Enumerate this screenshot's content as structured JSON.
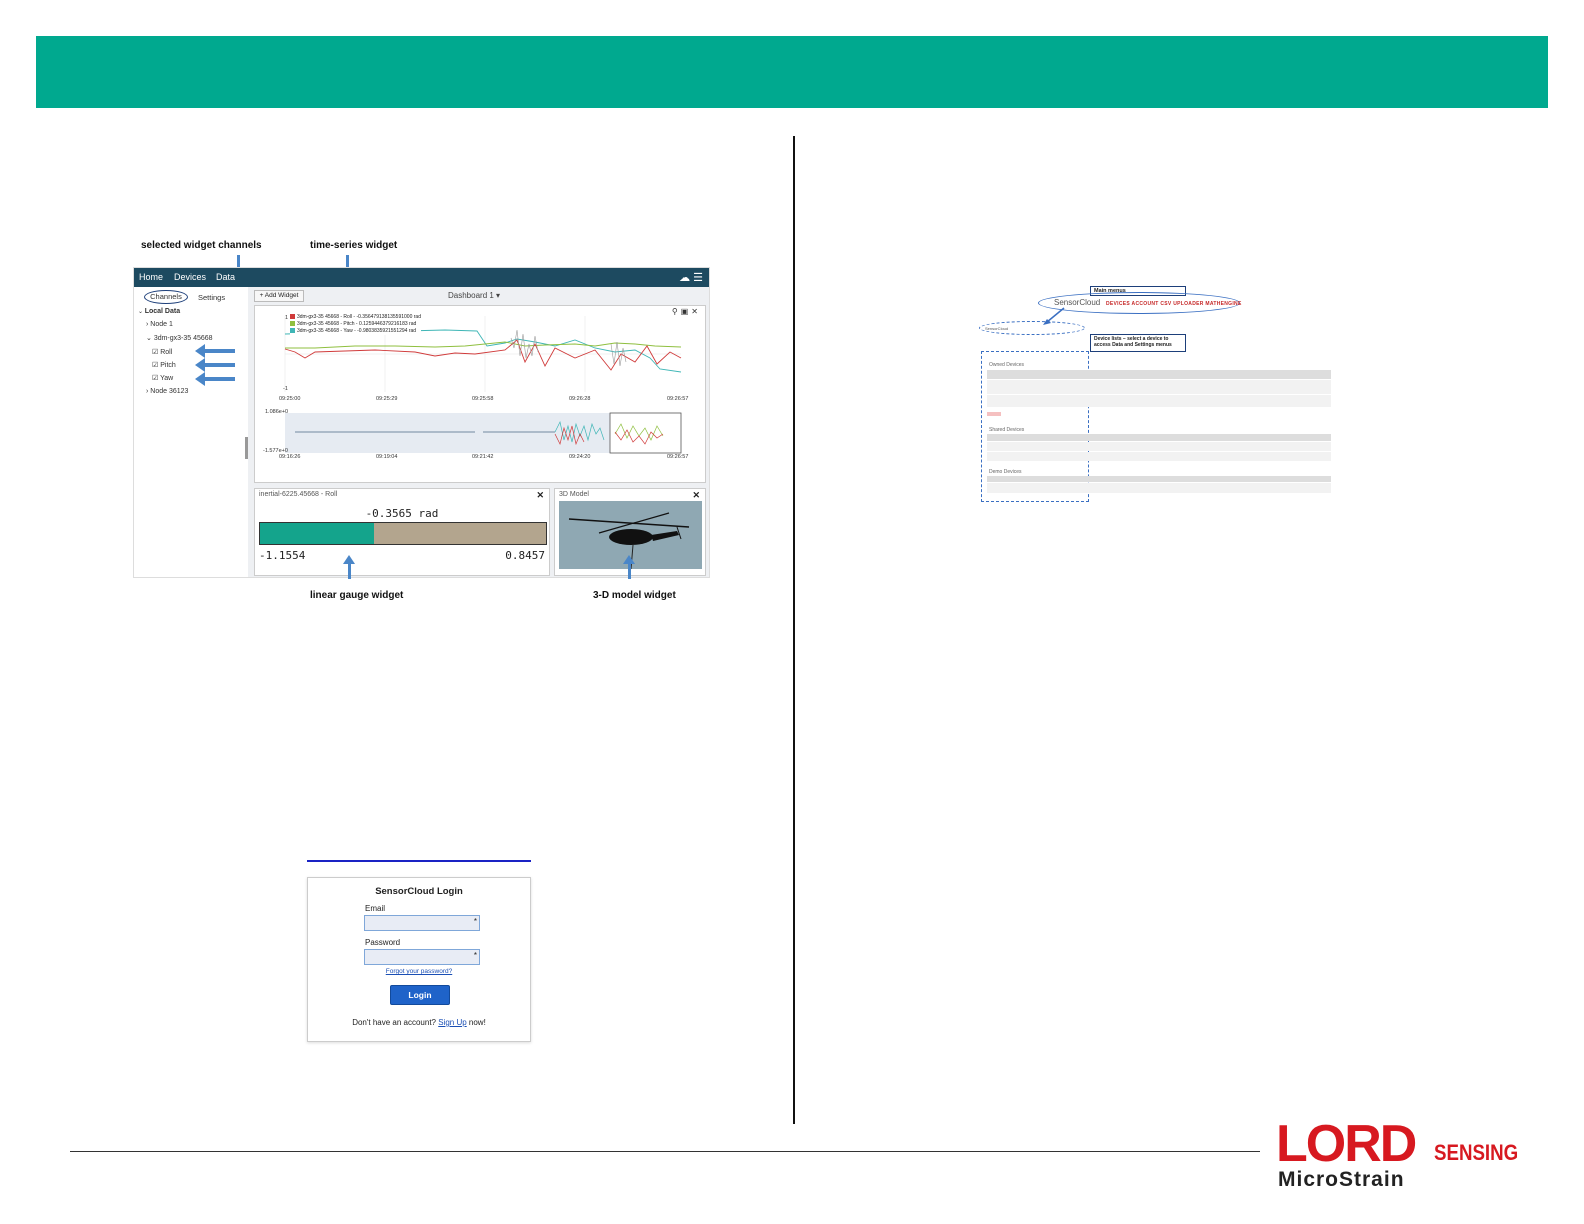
{
  "dashboard_figure": {
    "annotations": {
      "selected_widget_channels": "selected widget channels",
      "time_series_widget": "time-series widget",
      "linear_gauge_widget": "linear gauge widget",
      "model_widget": "3-D model widget"
    },
    "nav": {
      "home": "Home",
      "devices": "Devices",
      "data": "Data"
    },
    "sidebar": {
      "tab_channels": "Channels",
      "tab_settings": "Settings",
      "root": "Local Data",
      "node1": "Node 1",
      "device": "3dm-gx3-35 45668",
      "channels": [
        "Roll",
        "Pitch",
        "Yaw"
      ],
      "node2": "Node 36123"
    },
    "add_widget": "+ Add Widget",
    "dashboard_title": "Dashboard 1 ▾",
    "legend": [
      {
        "label": "3dm-gx3-35 45668 - Roll - -0.356479138135591000 rad",
        "color": "#d03b3b"
      },
      {
        "label": "3dm-gx3-35 45668 - Pitch - 0.1259446379216183 rad",
        "color": "#8fbf3f"
      },
      {
        "label": "3dm-gx3-35 45668 - Yaw - -0.9803835921551294 rad",
        "color": "#3fb6b6"
      }
    ],
    "ts_y_top": "1",
    "ts_y_bottom": "-1",
    "ts_x_ticks": [
      "09:25:00",
      "09:25:29",
      "09:25:58",
      "09:26:28",
      "09:26:57"
    ],
    "overview_y_top": "1.086e+0",
    "overview_y_bottom": "-1.577e+0",
    "overview_x_ticks": [
      "09:16:26",
      "09:19:04",
      "09:21:42",
      "09:24:20",
      "09:26:57"
    ],
    "gauge": {
      "title": "inertial-6225.45668 - Roll",
      "value": "-0.3565 rad",
      "min": "-1.1554",
      "max": "0.8457",
      "fill_fraction": 0.399
    },
    "model_title": "3D Model"
  },
  "devices_figure": {
    "main_menus_callout": "Main menus",
    "logo_text": "SensorCloud",
    "menu": "DEVICES   ACCOUNT   CSV UPLOADER   MATHENGINE",
    "device_lists_callout": "Device lists – select a device to access Data and Settings menus",
    "owned_devices": "Owned Devices",
    "shared_devices": "Shared Devices",
    "demo_devices": "Demo Devices"
  },
  "login": {
    "title": "SensorCloud Login",
    "email_label": "Email",
    "password_label": "Password",
    "required_mark": "*",
    "forgot": "Forgot your password?",
    "button": "Login",
    "signup_prefix": "Don't have an account? ",
    "signup_link": "Sign Up",
    "signup_suffix": " now!"
  },
  "logo": {
    "word": "LORD",
    "sensing": "SENSING",
    "sub": "MicroStrain"
  },
  "colors": {
    "banner": "#00a98f",
    "logo_red": "#d71920",
    "accent_blue": "#4a86c8"
  }
}
